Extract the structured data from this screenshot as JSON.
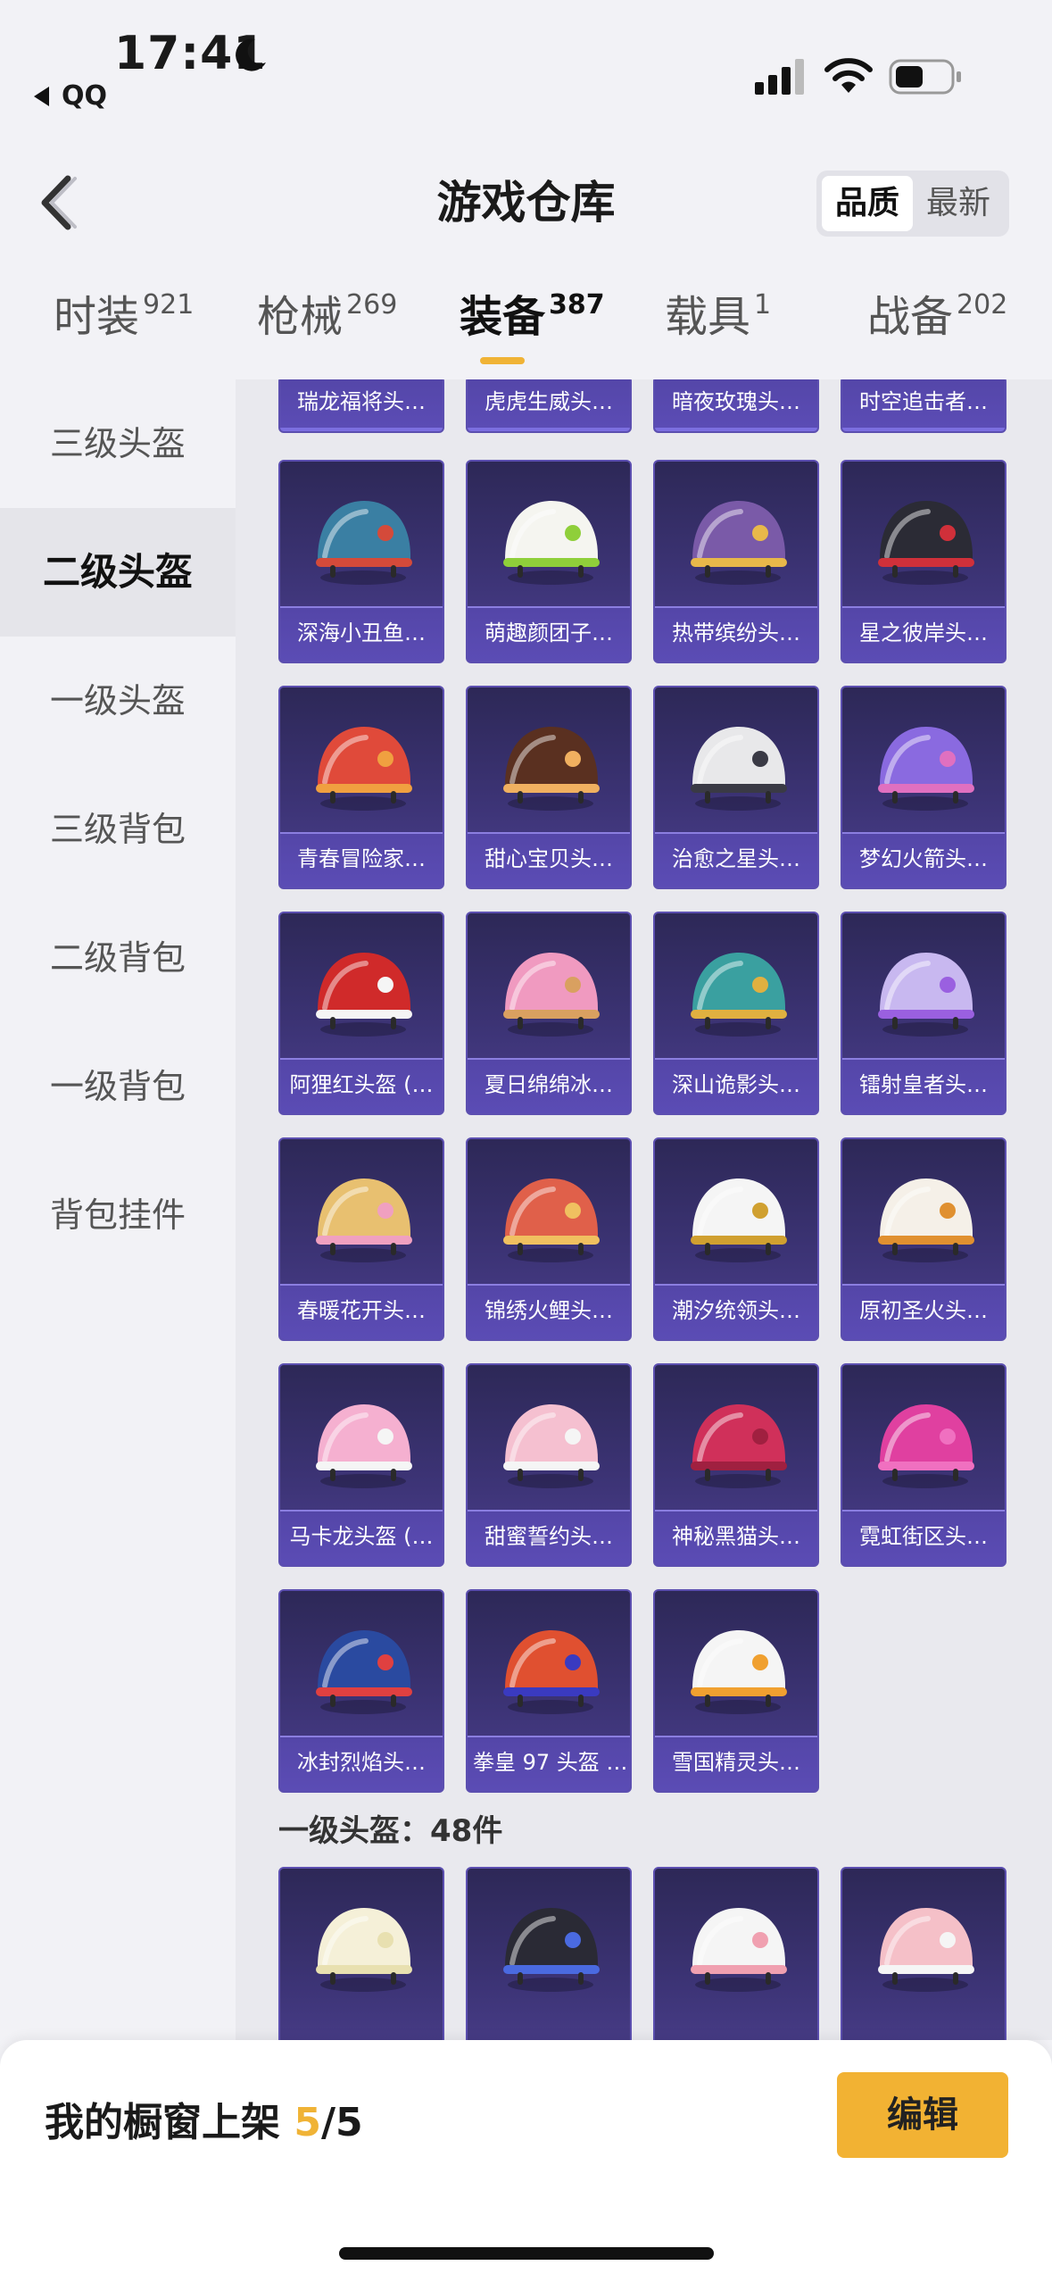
{
  "status": {
    "time": "17:41",
    "back_app": "QQ"
  },
  "nav": {
    "title": "游戏仓库",
    "sort": [
      "品质",
      "最新"
    ]
  },
  "tabs": [
    {
      "label": "时装",
      "count": "921"
    },
    {
      "label": "枪械",
      "count": "269"
    },
    {
      "label": "装备",
      "count": "387"
    },
    {
      "label": "载具",
      "count": "1"
    },
    {
      "label": "战备",
      "count": "202"
    }
  ],
  "sidebar": [
    {
      "label": "三级头盔"
    },
    {
      "label": "二级头盔"
    },
    {
      "label": "一级头盔"
    },
    {
      "label": "三级背包"
    },
    {
      "label": "二级背包"
    },
    {
      "label": "一级背包"
    },
    {
      "label": "背包挂件"
    }
  ],
  "top_row": [
    "瑞龙福将头…",
    "虎虎生威头…",
    "暗夜玫瑰头…",
    "时空追击者…"
  ],
  "items": [
    {
      "name": "深海小丑鱼…",
      "colors": [
        "#3a7fa3",
        "#d44a3a"
      ]
    },
    {
      "name": "萌趣颜团子…",
      "colors": [
        "#f5f5f0",
        "#8fcf3a"
      ]
    },
    {
      "name": "热带缤纷头…",
      "colors": [
        "#7a5aa8",
        "#e8b84a"
      ]
    },
    {
      "name": "星之彼岸头…",
      "colors": [
        "#2b2b35",
        "#d0303a"
      ]
    },
    {
      "name": "青春冒险家…",
      "colors": [
        "#e04a3a",
        "#f0a040"
      ]
    },
    {
      "name": "甜心宝贝头…",
      "colors": [
        "#5a3020",
        "#f0b060"
      ]
    },
    {
      "name": "治愈之星头…",
      "colors": [
        "#e8e8ea",
        "#3a3a45"
      ]
    },
    {
      "name": "梦幻火箭头…",
      "colors": [
        "#8a6ae0",
        "#e070c0"
      ]
    },
    {
      "name": "阿狸红头盔 (…",
      "colors": [
        "#d02a2a",
        "#f5f5f5"
      ]
    },
    {
      "name": "夏日绵绵冰…",
      "colors": [
        "#f09ac0",
        "#d9a060"
      ]
    },
    {
      "name": "深山诡影头…",
      "colors": [
        "#3aa0a0",
        "#e0b040"
      ]
    },
    {
      "name": "镭射皇者头…",
      "colors": [
        "#c8b8f0",
        "#9a60e0"
      ]
    },
    {
      "name": "春暖花开头…",
      "colors": [
        "#e8c070",
        "#f0a0c0"
      ]
    },
    {
      "name": "锦绣火鲤头…",
      "colors": [
        "#e0604a",
        "#f0c060"
      ]
    },
    {
      "name": "潮汐统领头…",
      "colors": [
        "#f5f5f5",
        "#d0a030"
      ]
    },
    {
      "name": "原初圣火头…",
      "colors": [
        "#f5f0e8",
        "#e09030"
      ]
    },
    {
      "name": "马卡龙头盔 (…",
      "colors": [
        "#f5b0d0",
        "#f5f5f5"
      ]
    },
    {
      "name": "甜蜜誓约头…",
      "colors": [
        "#f5c0d0",
        "#f5f5f5"
      ]
    },
    {
      "name": "神秘黑猫头…",
      "colors": [
        "#d0305a",
        "#a02040"
      ]
    },
    {
      "name": "霓虹街区头…",
      "colors": [
        "#e040a0",
        "#f070c0"
      ]
    },
    {
      "name": "冰封烈焰头…",
      "colors": [
        "#2a4aa0",
        "#e04040"
      ]
    },
    {
      "name": "拳皇 97 头盔 …",
      "colors": [
        "#e05030",
        "#3a3ac0"
      ]
    },
    {
      "name": "雪国精灵头…",
      "colors": [
        "#f5f5f5",
        "#f0a030"
      ]
    }
  ],
  "section": {
    "title": "一级头盔：48件"
  },
  "bottom_items": [
    {
      "colors": [
        "#f5f0d8",
        "#e8e0b0"
      ]
    },
    {
      "colors": [
        "#2a2a35",
        "#4a6ae0"
      ]
    },
    {
      "colors": [
        "#f5f5f5",
        "#f0a0b0"
      ]
    },
    {
      "colors": [
        "#f5c0c8",
        "#f5f5f5"
      ]
    }
  ],
  "footer": {
    "label": "我的橱窗上架 ",
    "current": "5",
    "total": "/5",
    "edit": "编辑"
  }
}
